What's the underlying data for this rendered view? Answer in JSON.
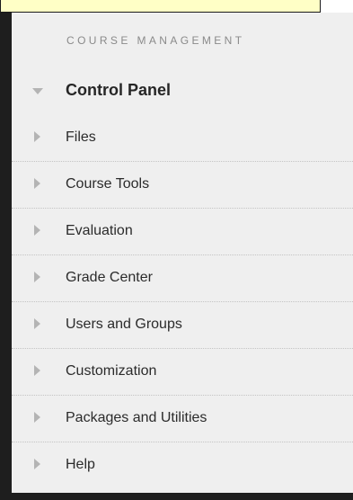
{
  "section": {
    "title": "COURSE MANAGEMENT"
  },
  "menu": {
    "items": [
      {
        "label": "Control Panel",
        "state": "expanded",
        "icon": "triangle-down-icon"
      },
      {
        "label": "Files",
        "state": "collapsed",
        "icon": "triangle-right-icon"
      },
      {
        "label": "Course Tools",
        "state": "collapsed",
        "icon": "triangle-right-icon"
      },
      {
        "label": "Evaluation",
        "state": "collapsed",
        "icon": "triangle-right-icon"
      },
      {
        "label": "Grade Center",
        "state": "collapsed",
        "icon": "triangle-right-icon"
      },
      {
        "label": "Users and Groups",
        "state": "collapsed",
        "icon": "triangle-right-icon"
      },
      {
        "label": "Customization",
        "state": "collapsed",
        "icon": "triangle-right-icon"
      },
      {
        "label": "Packages and Utilities",
        "state": "collapsed",
        "icon": "triangle-right-icon"
      },
      {
        "label": "Help",
        "state": "collapsed",
        "icon": "triangle-right-icon"
      }
    ]
  },
  "colors": {
    "panel_background": "#efefef",
    "frame": "#1e1e1e",
    "banner_background": "#ffffc6",
    "arrow": "#b4b4b4",
    "header_text": "#8a8a8a"
  }
}
